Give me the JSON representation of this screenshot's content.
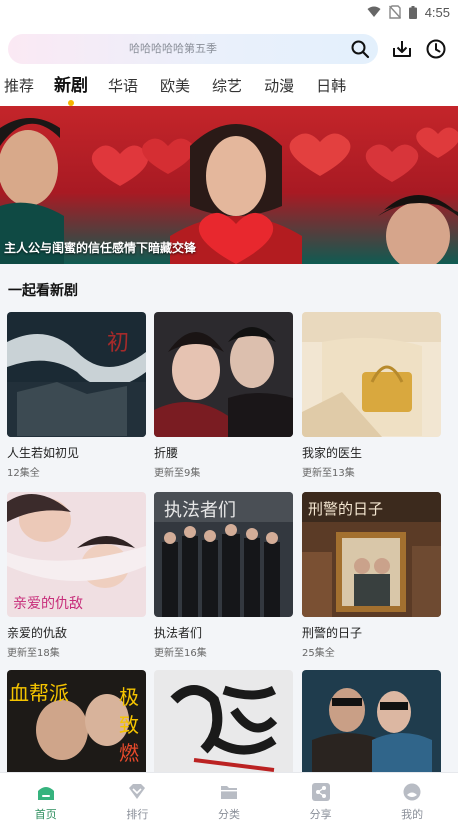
{
  "status_bar": {
    "time": "4:55",
    "icons": [
      "wifi-icon",
      "no-sim-icon",
      "battery-icon"
    ]
  },
  "search": {
    "placeholder": "哈哈哈哈哈第五季"
  },
  "toolbar": {
    "icons": [
      "search-icon",
      "download-icon",
      "history-icon"
    ]
  },
  "tabs": [
    {
      "label": "推荐",
      "active": false
    },
    {
      "label": "新剧",
      "active": true
    },
    {
      "label": "华语",
      "active": false
    },
    {
      "label": "欧美",
      "active": false
    },
    {
      "label": "综艺",
      "active": false
    },
    {
      "label": "动漫",
      "active": false
    },
    {
      "label": "日韩",
      "active": false
    }
  ],
  "banner": {
    "caption": "主人公与闺蜜的信任感情下暗藏交锋"
  },
  "section": {
    "title": "一起看新剧"
  },
  "cards": [
    {
      "title": "人生若如初见",
      "subtitle": "12集全"
    },
    {
      "title": "折腰",
      "subtitle": "更新至9集"
    },
    {
      "title": "我家的医生",
      "subtitle": "更新至13集"
    },
    {
      "title": "亲爱的仇敌",
      "subtitle": "更新至18集"
    },
    {
      "title": "执法者们",
      "subtitle": "更新至16集"
    },
    {
      "title": "刑警的日子",
      "subtitle": "25集全"
    },
    {
      "title": "",
      "subtitle": ""
    },
    {
      "title": "",
      "subtitle": ""
    },
    {
      "title": "",
      "subtitle": ""
    }
  ],
  "bottom_nav": [
    {
      "label": "首页",
      "icon": "home-icon",
      "active": true
    },
    {
      "label": "排行",
      "icon": "ranking-icon",
      "active": false
    },
    {
      "label": "分类",
      "icon": "folder-icon",
      "active": false
    },
    {
      "label": "分享",
      "icon": "share-icon",
      "active": false
    },
    {
      "label": "我的",
      "icon": "profile-icon",
      "active": false
    }
  ],
  "colors": {
    "accent": "#f5b400",
    "nav_active": "#2f8f5f",
    "background": "#f3f5f8"
  }
}
